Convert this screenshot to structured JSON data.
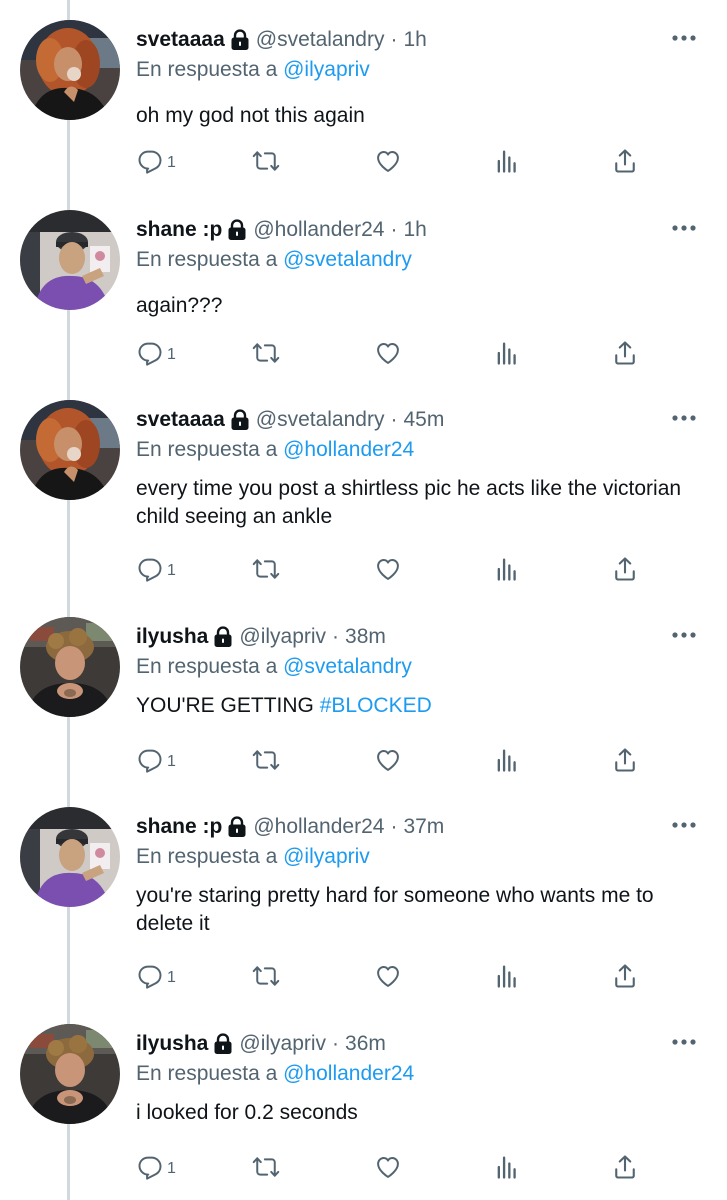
{
  "tweets": [
    {
      "name": "svetaaaa",
      "handle": "@svetalandry",
      "time": "1h",
      "reply_prefix": "En respuesta a",
      "reply_to": "@ilyapriv",
      "text": "oh my god not this again",
      "hashtag": "",
      "reply_count": "1",
      "avatar": "svetaaaa-avatar"
    },
    {
      "name": "shane :p",
      "handle": "@hollander24",
      "time": "1h",
      "reply_prefix": "En respuesta a",
      "reply_to": "@svetalandry",
      "text": "again???",
      "hashtag": "",
      "reply_count": "1",
      "avatar": "shane-avatar"
    },
    {
      "name": "svetaaaa",
      "handle": "@svetalandry",
      "time": "45m",
      "reply_prefix": "En respuesta a",
      "reply_to": "@hollander24",
      "text": "every time you post a shirtless pic he acts like the victorian child seeing an ankle",
      "hashtag": "",
      "reply_count": "1",
      "avatar": "svetaaaa-avatar"
    },
    {
      "name": "ilyusha",
      "handle": "@ilyapriv",
      "time": "38m",
      "reply_prefix": "En respuesta a",
      "reply_to": "@svetalandry",
      "text": "YOU'RE GETTING ",
      "hashtag": "#BLOCKED",
      "reply_count": "1",
      "avatar": "ilyusha-avatar"
    },
    {
      "name": "shane :p",
      "handle": "@hollander24",
      "time": "37m",
      "reply_prefix": "En respuesta a",
      "reply_to": "@ilyapriv",
      "text": "you're staring pretty hard for someone who wants me to delete it",
      "hashtag": "",
      "reply_count": "1",
      "avatar": "shane-avatar"
    },
    {
      "name": "ilyusha",
      "handle": "@ilyapriv",
      "time": "36m",
      "reply_prefix": "En respuesta a",
      "reply_to": "@hollander24",
      "text": "i looked for 0.2 seconds",
      "hashtag": "",
      "reply_count": "1",
      "avatar": "ilyusha-avatar"
    }
  ],
  "colors": {
    "link": "#1d9bf0",
    "secondary_text": "#536471",
    "primary_text": "#0f1419",
    "thread_line": "#cfd9de"
  },
  "icons": [
    "reply-icon",
    "retweet-icon",
    "like-icon",
    "views-icon",
    "share-icon",
    "more-icon",
    "lock-icon"
  ]
}
